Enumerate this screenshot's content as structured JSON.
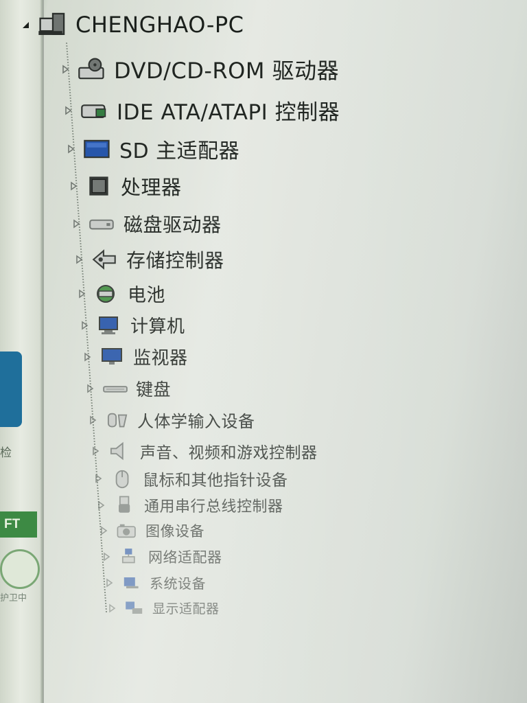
{
  "left_pane": {
    "fragment_1": "检",
    "badge": "FT",
    "fragment_2": "护卫中"
  },
  "tree": {
    "root": {
      "label": "CHENGHAO-PC",
      "icon": "computer-root-icon",
      "expanded": true
    },
    "items": [
      {
        "label": "DVD/CD-ROM 驱动器",
        "icon": "dvd-drive-icon"
      },
      {
        "label": "IDE ATA/ATAPI 控制器",
        "icon": "ide-controller-icon"
      },
      {
        "label": "SD 主适配器",
        "icon": "sd-adapter-icon"
      },
      {
        "label": "处理器",
        "icon": "processor-icon"
      },
      {
        "label": "磁盘驱动器",
        "icon": "disk-drive-icon"
      },
      {
        "label": "存储控制器",
        "icon": "storage-controller-icon"
      },
      {
        "label": "电池",
        "icon": "battery-icon"
      },
      {
        "label": "计算机",
        "icon": "computer-icon"
      },
      {
        "label": "监视器",
        "icon": "monitor-icon"
      },
      {
        "label": "键盘",
        "icon": "keyboard-icon"
      },
      {
        "label": "人体学输入设备",
        "icon": "hid-icon"
      },
      {
        "label": "声音、视频和游戏控制器",
        "icon": "speaker-icon"
      },
      {
        "label": "鼠标和其他指针设备",
        "icon": "mouse-icon"
      },
      {
        "label": "通用串行总线控制器",
        "icon": "usb-icon"
      },
      {
        "label": "图像设备",
        "icon": "camera-icon"
      },
      {
        "label": "网络适配器",
        "icon": "network-adapter-icon"
      },
      {
        "label": "系统设备",
        "icon": "system-device-icon"
      },
      {
        "label": "显示适配器",
        "icon": "display-adapter-icon"
      }
    ]
  },
  "colors": {
    "text": "#1a1f1b",
    "text_faded": "#4d5650",
    "icon_blue": "#1e4fa8",
    "icon_gray": "#6f7471",
    "background": "#e2e6df"
  }
}
